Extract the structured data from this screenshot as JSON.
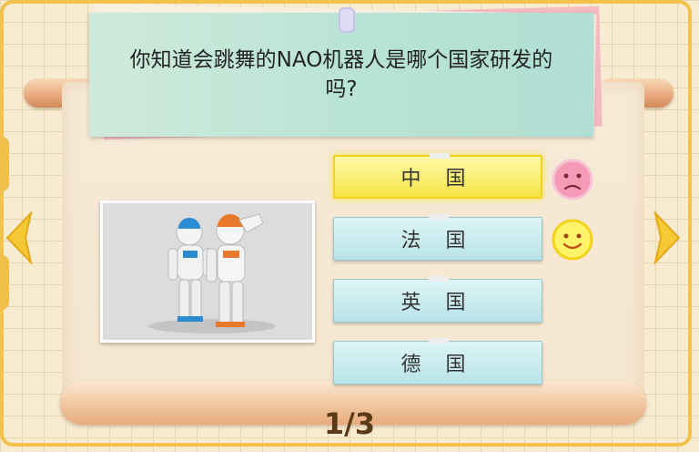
{
  "question": {
    "text": "你知道会跳舞的NAO机器人是哪个国家研发的吗?"
  },
  "options": [
    {
      "label": "中 国",
      "state": "selected",
      "feedback": "sad-face-icon"
    },
    {
      "label": "法 国",
      "state": "normal",
      "feedback": "smiley-face-icon"
    },
    {
      "label": "英 国",
      "state": "normal",
      "feedback": ""
    },
    {
      "label": "德 国",
      "state": "normal",
      "feedback": ""
    }
  ],
  "progress": {
    "label": "1/3",
    "current": 1,
    "total": 3
  },
  "navigation": {
    "prev_icon": "left-arrow-icon",
    "next_icon": "right-arrow-icon"
  },
  "image": {
    "subject": "nao-robots-photo"
  },
  "colors": {
    "background": "#f7ecd2",
    "card": "#b6e3d4",
    "selected_option": "#f7e347",
    "option": "#c6ebee",
    "accent": "#f2c24a",
    "counter_text": "#5b3a18"
  }
}
